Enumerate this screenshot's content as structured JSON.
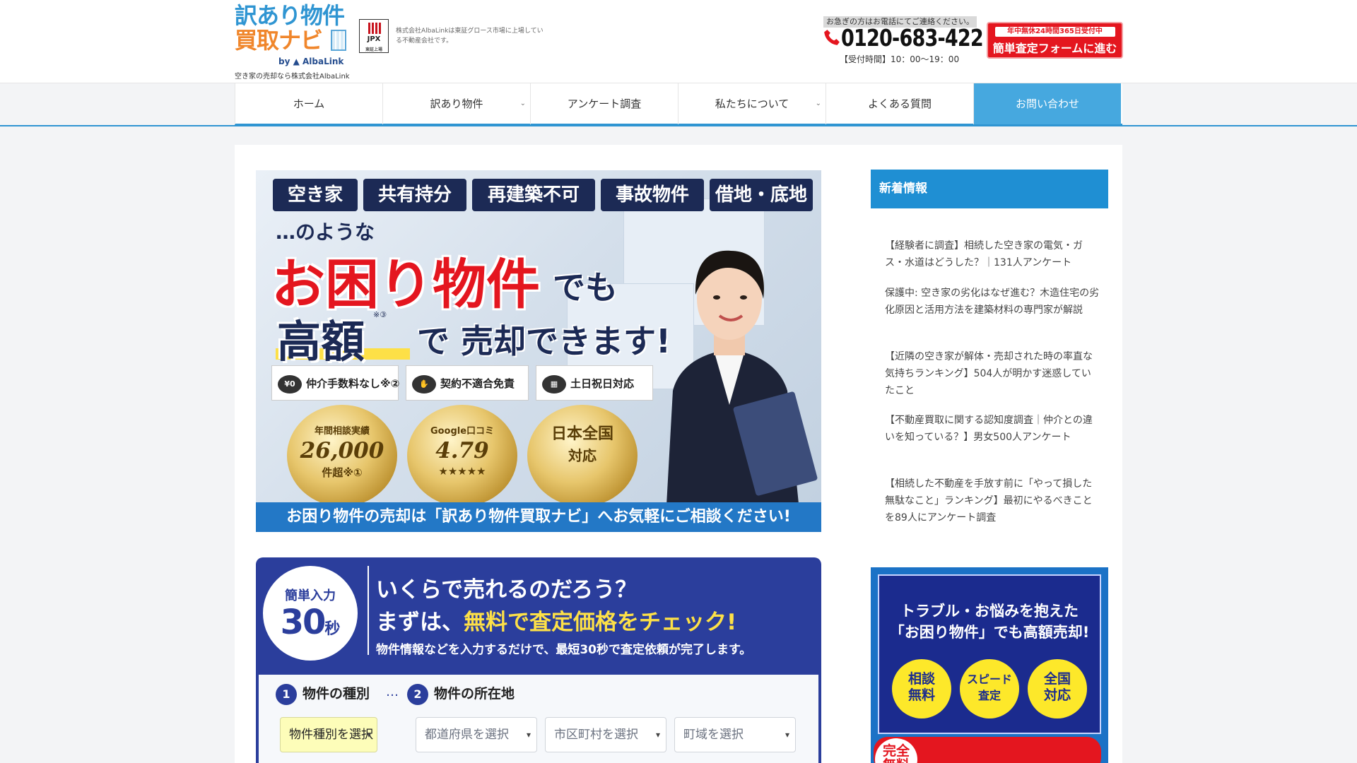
{
  "header": {
    "logo_line1": "訳あり物件",
    "logo_line2": "買取ナビ",
    "logo_by": "by ▲ AlbaLink",
    "logo_tagline": "空き家の売却なら株式会社AlbaLink",
    "jpx_label": "JPX",
    "jpx_sub": "東証上場",
    "listed_text": "株式会社AlbaLinkは東証グロース市場に上場している不動産会社です。",
    "contact_note": "お急ぎの方はお電話にてご連絡ください。",
    "phone": "0120-683-422",
    "hours": "【受付時間】10：00～19：00",
    "cta_line1": "年中無休24時間365日受付中",
    "cta_line2": "簡単査定フォームに進む"
  },
  "nav": {
    "items": [
      {
        "label": "ホーム",
        "chevron": ""
      },
      {
        "label": "訳あり物件",
        "chevron": "⌄"
      },
      {
        "label": "アンケート調査",
        "chevron": ""
      },
      {
        "label": "私たちについて",
        "chevron": "⌄"
      },
      {
        "label": "よくある質問",
        "chevron": ""
      },
      {
        "label": "お問い合わせ",
        "chevron": ""
      }
    ]
  },
  "hero": {
    "tags": [
      "空き家",
      "共有持分",
      "再建築不可",
      "事故物件",
      "借地・底地"
    ],
    "sub": "…のような",
    "main": "お困り物件",
    "main_suffix": "でも",
    "high": "高額",
    "high_note": "※③",
    "sell": "で 売却できます!",
    "features": [
      {
        "icon": "¥0",
        "label": "仲介手数料なし※②"
      },
      {
        "icon": "✋",
        "label": "契約不適合免責"
      },
      {
        "icon": "▦",
        "label": "土日祝日対応"
      }
    ],
    "medals": [
      {
        "l1": "年間相談実績",
        "l2": "26,000",
        "l3": "件超※①"
      },
      {
        "l1": "Google口コミ",
        "l2": "4.79",
        "l3": "★★★★★"
      },
      {
        "l1": "",
        "l2": "日本全国",
        "l3": "対応"
      }
    ],
    "band": "お困り物件の売却は「訳あり物件買取ナビ」へお気軽にご相談ください!"
  },
  "form": {
    "circle_l1": "簡単入力",
    "circle_num": "30",
    "circle_unit": "秒",
    "heading1": "いくらで売れるのだろう？",
    "heading2_prefix": "まずは、",
    "heading2_highlight": "無料で査定価格をチェック!",
    "subtext": "物件情報などを入力するだけで、最短30秒で査定依頼が完了します。",
    "step1_num": "1",
    "step1_label": "物件の種別",
    "step_dots": "…",
    "step2_num": "2",
    "step2_label": "物件の所在地",
    "selects": [
      {
        "value": "物件種別を選択"
      },
      {
        "value": "都道府県を選択"
      },
      {
        "value": "市区町村を選択"
      },
      {
        "value": "町域を選択"
      }
    ]
  },
  "sidebar": {
    "news_title": "新着情報",
    "news": [
      "【経験者に調査】相続した空き家の電気・ガス・水道はどうした？｜131人アンケート",
      "保護中: 空き家の劣化はなぜ進む？木造住宅の劣化原因と活用方法を建築材料の専門家が解説",
      "【近隣の空き家が解体・売却された時の率直な気持ちランキング】504人が明かす迷惑していたこと",
      "【不動産買取に関する認知度調査｜仲介との違いを知っている？】男女500人アンケート",
      "【相続した不動産を手放す前に「やって損した無駄なこと」ランキング】最初にやるべきことを89人にアンケート調査"
    ],
    "banner_line1": "トラブル・お悩みを抱えた",
    "banner_line2": "「お困り物件」でも高額売却!",
    "banner_circles": [
      "相談\n無料",
      "スピード\n査定",
      "全国\n対応"
    ],
    "banner_free": "完全\n無料"
  },
  "colors": {
    "brand_blue": "#2f95d2",
    "accent_red": "#e4161f",
    "navy": "#1c2a55",
    "form_blue": "#2b3e9c",
    "highlight_yellow": "#fde047"
  }
}
